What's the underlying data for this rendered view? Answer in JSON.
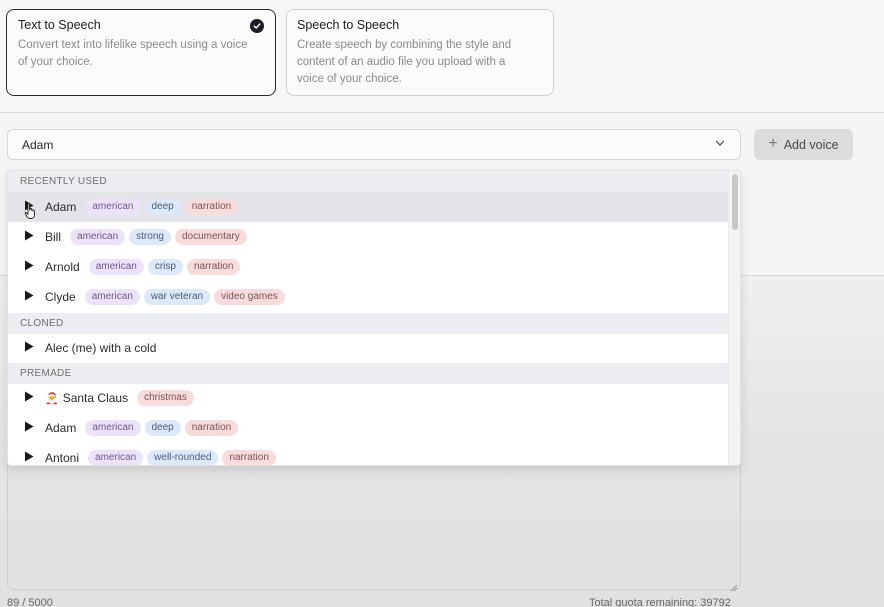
{
  "modes": [
    {
      "title": "Text to Speech",
      "description": "Convert text into lifelike speech using a voice of your choice.",
      "selected": true
    },
    {
      "title": "Speech to Speech",
      "description": "Create speech by combining the style and content of an audio file you upload with a voice of your choice.",
      "selected": false
    }
  ],
  "voice_select": {
    "value": "Adam"
  },
  "add_voice": {
    "label": "Add voice",
    "icon": "plus-icon"
  },
  "dropdown": {
    "recently_used": {
      "header": "RECENTLY USED",
      "voices": [
        {
          "name": "Adam",
          "tags": [
            "american",
            "deep",
            "narration"
          ]
        },
        {
          "name": "Bill",
          "tags": [
            "american",
            "strong",
            "documentary"
          ]
        },
        {
          "name": "Arnold",
          "tags": [
            "american",
            "crisp",
            "narration"
          ]
        },
        {
          "name": "Clyde",
          "tags": [
            "american",
            "war veteran",
            "video games"
          ]
        }
      ]
    },
    "cloned": {
      "header": "CLONED",
      "voices": [
        {
          "name": "Alec (me) with a cold",
          "tags": []
        }
      ]
    },
    "premade": {
      "header": "PREMADE",
      "voices": [
        {
          "name": "Santa Claus",
          "emoji": "🎅",
          "tags": [
            "christmas"
          ]
        },
        {
          "name": "Adam",
          "tags": [
            "american",
            "deep",
            "narration"
          ]
        },
        {
          "name": "Antoni",
          "tags": [
            "american",
            "well-rounded",
            "narration"
          ]
        }
      ]
    }
  },
  "footer": {
    "char_count": "89 / 5000",
    "quota": "Total quota remaining: 39792"
  },
  "colors": {
    "tag_accent": "#ece3fb",
    "tag_descriptor": "#dde8f9",
    "tag_use_case": "#f8dcdc",
    "selected_border": "#2a2a2a"
  }
}
